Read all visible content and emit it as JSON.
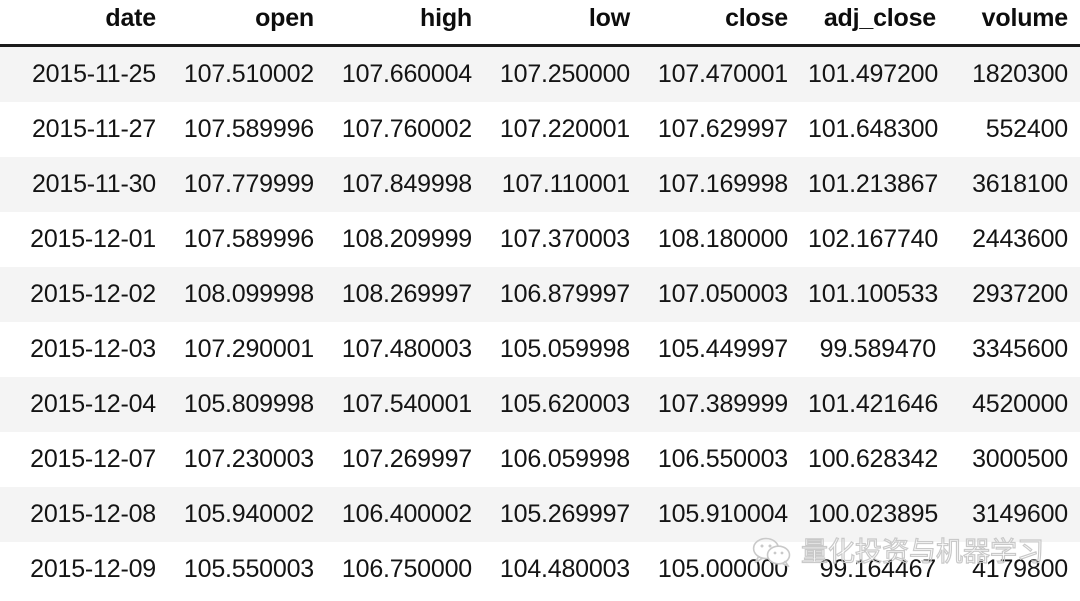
{
  "table": {
    "name": "stock-price-dataframe",
    "columns": [
      "date",
      "open",
      "high",
      "low",
      "close",
      "adj_close",
      "volume"
    ],
    "rows": [
      {
        "date": "2015-11-25",
        "open": "107.510002",
        "high": "107.660004",
        "low": "107.250000",
        "close": "107.470001",
        "adj_close": "101.497200",
        "volume": "1820300"
      },
      {
        "date": "2015-11-27",
        "open": "107.589996",
        "high": "107.760002",
        "low": "107.220001",
        "close": "107.629997",
        "adj_close": "101.648300",
        "volume": "552400"
      },
      {
        "date": "2015-11-30",
        "open": "107.779999",
        "high": "107.849998",
        "low": "107.110001",
        "close": "107.169998",
        "adj_close": "101.213867",
        "volume": "3618100"
      },
      {
        "date": "2015-12-01",
        "open": "107.589996",
        "high": "108.209999",
        "low": "107.370003",
        "close": "108.180000",
        "adj_close": "102.167740",
        "volume": "2443600"
      },
      {
        "date": "2015-12-02",
        "open": "108.099998",
        "high": "108.269997",
        "low": "106.879997",
        "close": "107.050003",
        "adj_close": "101.100533",
        "volume": "2937200"
      },
      {
        "date": "2015-12-03",
        "open": "107.290001",
        "high": "107.480003",
        "low": "105.059998",
        "close": "105.449997",
        "adj_close": "99.589470",
        "volume": "3345600"
      },
      {
        "date": "2015-12-04",
        "open": "105.809998",
        "high": "107.540001",
        "low": "105.620003",
        "close": "107.389999",
        "adj_close": "101.421646",
        "volume": "4520000"
      },
      {
        "date": "2015-12-07",
        "open": "107.230003",
        "high": "107.269997",
        "low": "106.059998",
        "close": "106.550003",
        "adj_close": "100.628342",
        "volume": "3000500"
      },
      {
        "date": "2015-12-08",
        "open": "105.940002",
        "high": "106.400002",
        "low": "105.269997",
        "close": "105.910004",
        "adj_close": "100.023895",
        "volume": "3149600"
      },
      {
        "date": "2015-12-09",
        "open": "105.550003",
        "high": "106.750000",
        "low": "104.480003",
        "close": "105.000000",
        "adj_close": "99.164467",
        "volume": "4179800"
      }
    ]
  },
  "watermark": {
    "icon": "wechat-icon",
    "text": "量化投资与机器学习",
    "color": "#c9c9c9"
  },
  "style": {
    "row_stripe_color": "#f4f4f4",
    "row_base_color": "#ffffff",
    "header_rule_color": "#1b1b1b",
    "text_color": "#141414"
  }
}
